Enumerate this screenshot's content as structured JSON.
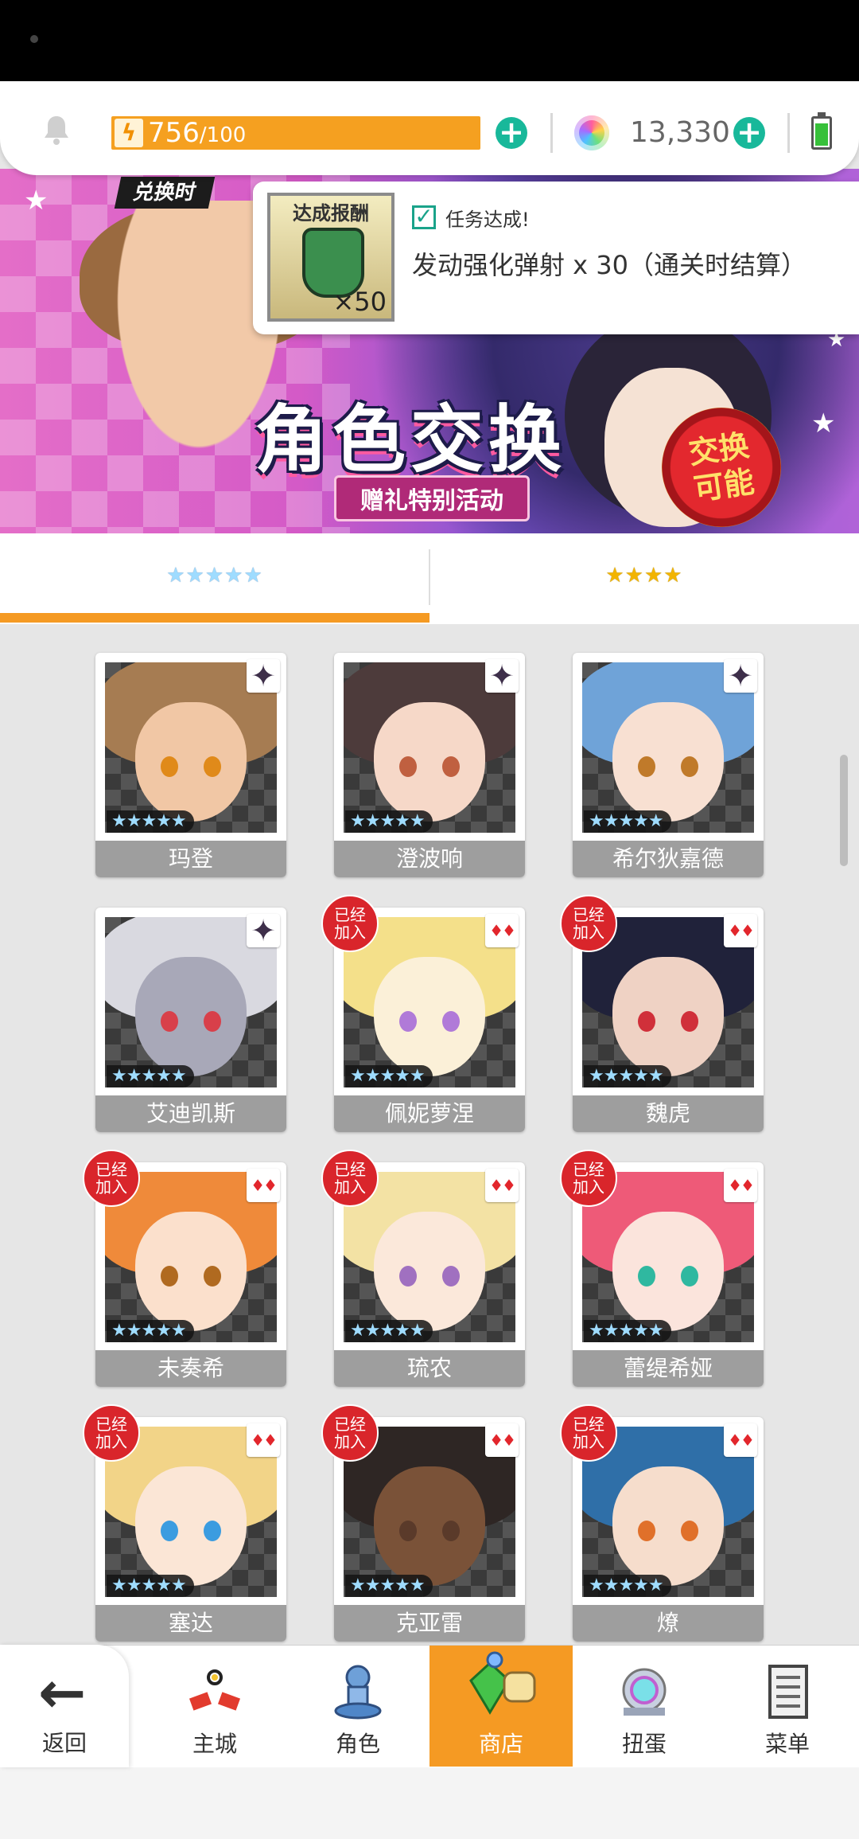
{
  "status": {
    "stamina_value": "756",
    "stamina_max": "/100",
    "gems": "13,330"
  },
  "banner": {
    "caption": "兑换时",
    "title": "角色交换",
    "subtitle": "赠礼特别活动",
    "badge_line1": "交换",
    "badge_line2": "可能"
  },
  "notification": {
    "thumb_label": "达成报酬",
    "item_count": "×50",
    "status": "任务达成!",
    "message": "发动强化弹射 x 30（通关时结算）"
  },
  "tabs": [
    {
      "label": "★★★★★",
      "active": true
    },
    {
      "label": "★★★★",
      "active": false
    }
  ],
  "characters": [
    {
      "name": "玛登",
      "element": "dark",
      "joined": false,
      "hair": "#a67c52",
      "skin": "#f1c7a5",
      "eyes": "#e08a1a"
    },
    {
      "name": "澄波响",
      "element": "dark",
      "joined": false,
      "hair": "#4d3b3b",
      "skin": "#f6d8c8",
      "eyes": "#c06040"
    },
    {
      "name": "希尔狄嘉德",
      "element": "dark",
      "joined": false,
      "hair": "#6fa3d8",
      "skin": "#f8e0d2",
      "eyes": "#c07a2a"
    },
    {
      "name": "艾迪凯斯",
      "element": "dark",
      "joined": false,
      "hair": "#d9d9e0",
      "skin": "#a8a8b8",
      "eyes": "#d8404a"
    },
    {
      "name": "佩妮萝涅",
      "element": "red",
      "joined": true,
      "hair": "#f4e08a",
      "skin": "#fbf0d8",
      "eyes": "#b07ad8"
    },
    {
      "name": "魏虎",
      "element": "red",
      "joined": true,
      "hair": "#20223a",
      "skin": "#efd2c4",
      "eyes": "#d0303a"
    },
    {
      "name": "未奏希",
      "element": "red",
      "joined": true,
      "hair": "#ef8a3a",
      "skin": "#fbe0cc",
      "eyes": "#b06a20"
    },
    {
      "name": "琉农",
      "element": "red",
      "joined": true,
      "hair": "#f3e2a4",
      "skin": "#fbe8da",
      "eyes": "#a070c0"
    },
    {
      "name": "蕾缇希娅",
      "element": "red",
      "joined": true,
      "hair": "#ee5a78",
      "skin": "#fbe4dc",
      "eyes": "#2fb8a0"
    },
    {
      "name": "塞达",
      "element": "red",
      "joined": true,
      "hair": "#f2d488",
      "skin": "#fbe6d6",
      "eyes": "#3b9ce0"
    },
    {
      "name": "克亚雷",
      "element": "red",
      "joined": true,
      "hair": "#2e2624",
      "skin": "#7a5238",
      "eyes": "#5a3a2a"
    },
    {
      "name": "燎",
      "element": "red",
      "joined": true,
      "hair": "#2f6fa8",
      "skin": "#f6ddcc",
      "eyes": "#e0702a"
    }
  ],
  "card_stars": "★★★★★",
  "joined_badge": "已经\n加入",
  "nav": {
    "back": "返回",
    "items": [
      {
        "label": "主城",
        "icon": "castle-icon",
        "active": false
      },
      {
        "label": "角色",
        "icon": "character-icon",
        "active": false
      },
      {
        "label": "商店",
        "icon": "shop-icon",
        "active": true
      },
      {
        "label": "扭蛋",
        "icon": "gacha-icon",
        "active": false
      },
      {
        "label": "菜单",
        "icon": "menu-icon",
        "active": false
      }
    ]
  }
}
